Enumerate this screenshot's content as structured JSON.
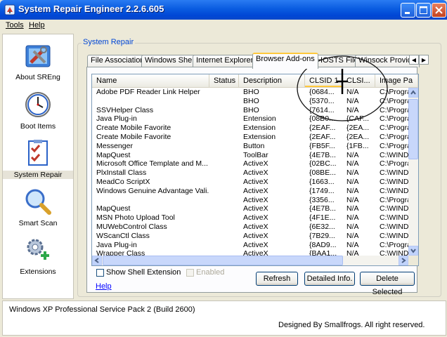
{
  "window": {
    "title": "System Repair Engineer 2.2.6.605"
  },
  "menu": {
    "tools": "Tools",
    "help": "Help"
  },
  "sidebar": {
    "items": [
      {
        "label": "About SREng",
        "icon": "tools-icon"
      },
      {
        "label": "Boot Items",
        "icon": "clock-icon"
      },
      {
        "label": "System Repair",
        "icon": "checklist-icon",
        "selected": true
      },
      {
        "label": "Smart Scan",
        "icon": "magnifier-icon"
      },
      {
        "label": "Extensions",
        "icon": "gears-icon"
      }
    ]
  },
  "group": {
    "title": "System Repair"
  },
  "tabs": [
    {
      "label": "File Association"
    },
    {
      "label": "Windows Shell"
    },
    {
      "label": "Internet Explorer"
    },
    {
      "label": "Browser Add-ons",
      "active": true
    },
    {
      "label": "HOSTS File"
    },
    {
      "label": "Winsock Provide"
    }
  ],
  "table": {
    "columns": [
      "Name",
      "Status",
      "Description",
      "CLSID 1",
      "CLSI...",
      "Image Pa"
    ],
    "sorted_column": "CLSID 1",
    "rows": [
      [
        "Adobe PDF Reader Link Helper",
        "",
        "BHO",
        "{0684...",
        "N/A",
        "C:\\Progra"
      ],
      [
        "",
        "",
        "BHO",
        "{5370...",
        "N/A",
        "C:\\Progra"
      ],
      [
        "SSVHelper Class",
        "",
        "BHO",
        "{7614...",
        "N/A",
        "C:\\Progra"
      ],
      [
        "Java Plug-in",
        "",
        "Entension",
        "{08B0...",
        "{CAF...",
        "C:\\Progra"
      ],
      [
        "Create Mobile Favorite",
        "",
        "Extension",
        "{2EAF...",
        "{2EA...",
        "C:\\Progra"
      ],
      [
        "Create Mobile Favorite",
        "",
        "Extension",
        "{2EAF...",
        "{2EA...",
        "C:\\Progra"
      ],
      [
        "Messenger",
        "",
        "Button",
        "{FB5F...",
        "{1FB...",
        "C:\\Progra"
      ],
      [
        "MapQuest",
        "",
        "ToolBar",
        "{4E7B...",
        "N/A",
        "C:\\WINDO"
      ],
      [
        "Microsoft Office Template and M...",
        "",
        "ActiveX",
        "{02BC...",
        "N/A",
        "C:\\Progra"
      ],
      [
        "PlxInstall Class",
        "",
        "ActiveX",
        "{08BE...",
        "N/A",
        "C:\\WINDO"
      ],
      [
        "MeadCo ScriptX",
        "",
        "ActiveX",
        "{1663...",
        "N/A",
        "C:\\WINDO"
      ],
      [
        "Windows Genuine Advantage Vali...",
        "",
        "ActiveX",
        "{1749...",
        "N/A",
        "C:\\WINDO"
      ],
      [
        "",
        "",
        "ActiveX",
        "{3356...",
        "N/A",
        "C:\\Progra"
      ],
      [
        "MapQuest",
        "",
        "ActiveX",
        "{4E7B...",
        "N/A",
        "C:\\WINDO"
      ],
      [
        "MSN Photo Upload Tool",
        "",
        "ActiveX",
        "{4F1E...",
        "N/A",
        "C:\\WINDO"
      ],
      [
        "MUWebControl Class",
        "",
        "ActiveX",
        "{6E32...",
        "N/A",
        "C:\\WINDO"
      ],
      [
        "WScanCtl Class",
        "",
        "ActiveX",
        "{7B29...",
        "N/A",
        "C:\\WINDO"
      ],
      [
        "Java Plug-in",
        "",
        "ActiveX",
        "{8AD9...",
        "N/A",
        "C:\\Progra"
      ],
      [
        "Wrapper Class",
        "",
        "ActiveX",
        "{BAA1...",
        "N/A",
        "C:\\WINDO"
      ]
    ]
  },
  "options": {
    "show_shell_extension": {
      "label": "Show Shell Extension",
      "checked": false
    },
    "enabled": {
      "label": "Enabled",
      "checked": false,
      "disabled": true
    }
  },
  "buttons": {
    "refresh": "Refresh",
    "detailed_info": "Detailed Info.",
    "delete_selected": "Delete Selected"
  },
  "help_link": "Help",
  "status": {
    "os": "Windows XP Professional Service Pack 2 (Build 2600)",
    "credit": "Designed By Smallfrogs. All right reserved."
  }
}
